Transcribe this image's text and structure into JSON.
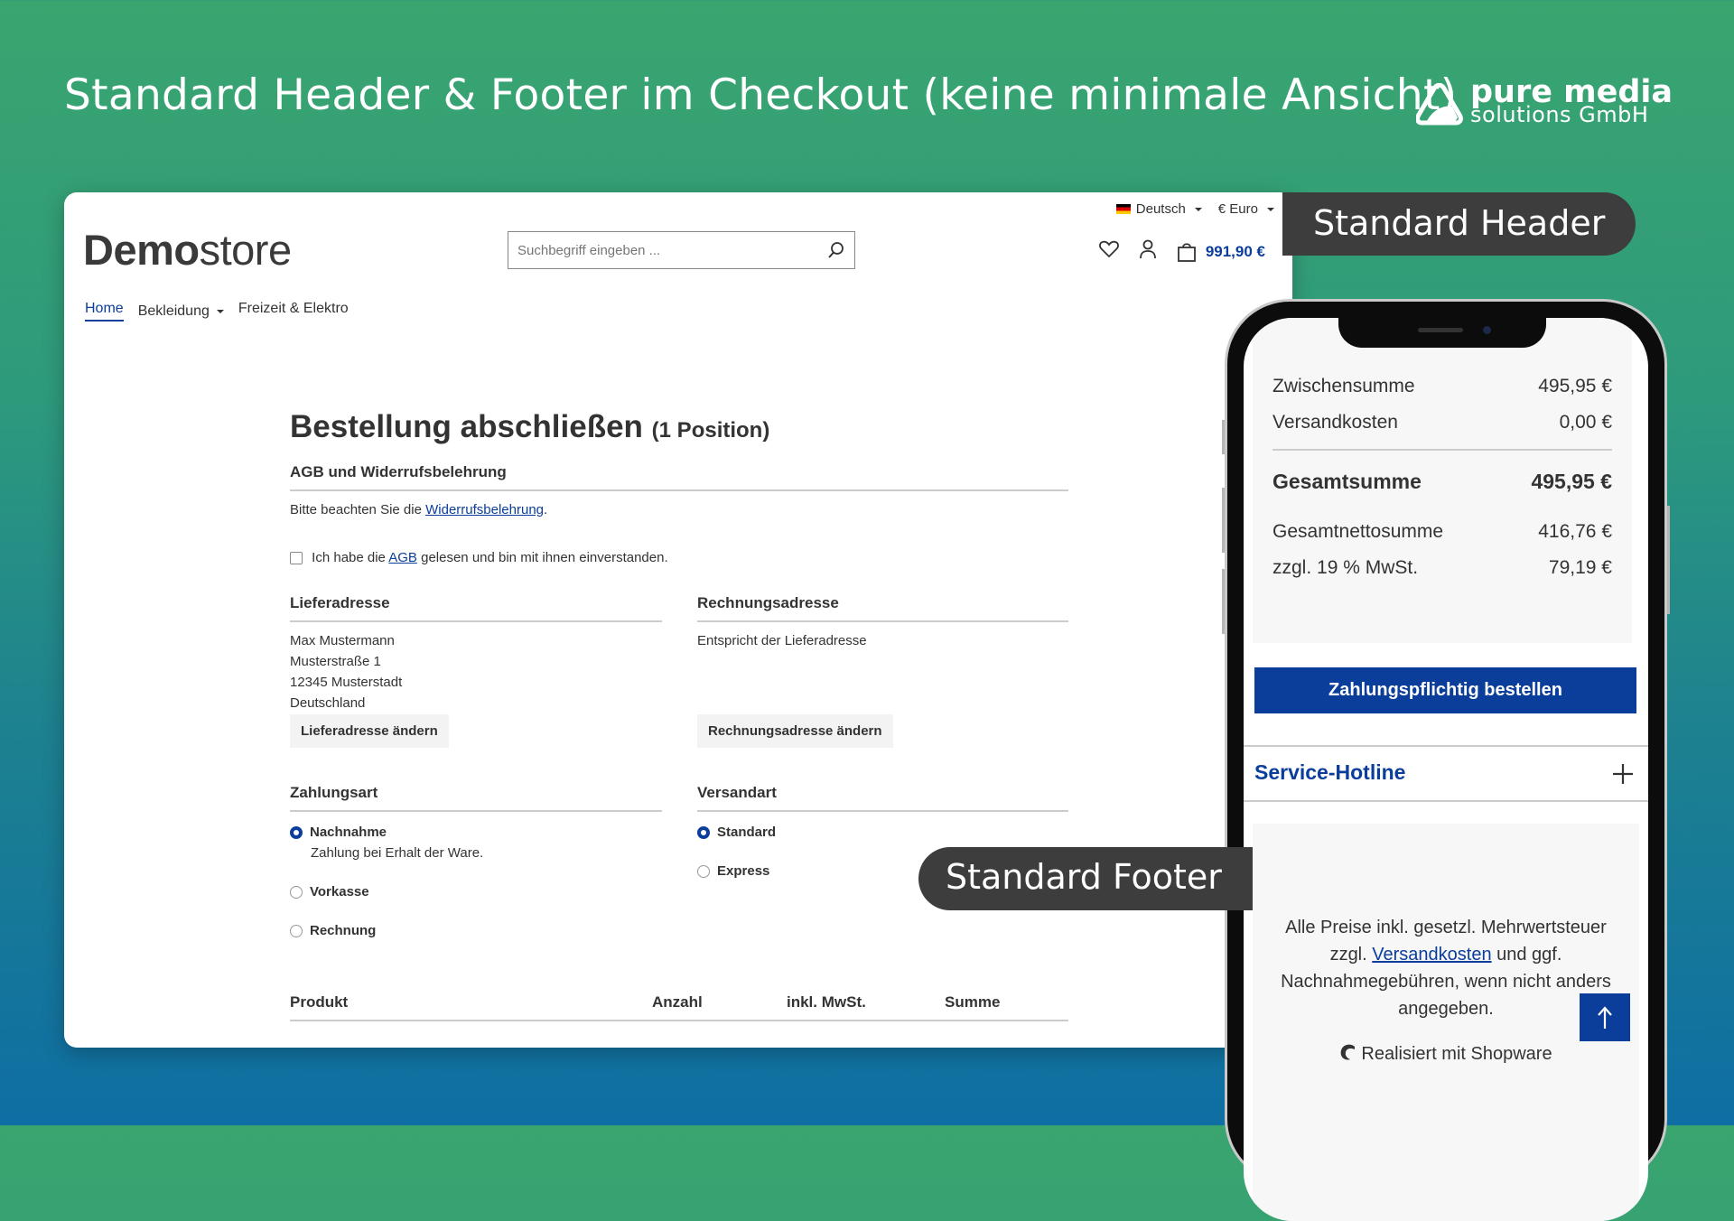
{
  "slide": {
    "headline": "Standard Header & Footer im Checkout (keine minimale Ansicht)",
    "brand_line1": "pure media",
    "brand_line2": "solutions GmbH",
    "label_header": "Standard Header",
    "label_footer": "Standard Footer"
  },
  "desktop": {
    "topbar": {
      "language": "Deutsch",
      "currency": "€ Euro"
    },
    "logo": {
      "bold": "Demo",
      "regular": "store"
    },
    "search": {
      "placeholder": "Suchbegriff eingeben ..."
    },
    "cart_total": "991,90 €",
    "nav": {
      "home": "Home",
      "clothing": "Bekleidung",
      "leisure": "Freizeit & Elektro"
    },
    "page": {
      "title": "Bestellung abschließen",
      "title_count": "(1 Position)",
      "terms_title": "AGB und Widerrufsbelehrung",
      "terms_text_before": "Bitte beachten Sie die ",
      "terms_link": "Widerrufsbelehrung",
      "terms_text_after": ".",
      "agb_before": "Ich habe die ",
      "agb_link": "AGB",
      "agb_after": " gelesen und bin mit ihnen einverstanden.",
      "shipping_title": "Lieferadresse",
      "shipping_address": [
        "Max Mustermann",
        "Musterstraße 1",
        "12345 Musterstadt",
        "Deutschland"
      ],
      "shipping_button": "Lieferadresse ändern",
      "billing_title": "Rechnungsadresse",
      "billing_text": "Entspricht der Lieferadresse",
      "billing_button": "Rechnungsadresse ändern",
      "payment_title": "Zahlungsart",
      "payment_options": [
        {
          "label": "Nachnahme",
          "desc": "Zahlung bei Erhalt der Ware.",
          "selected": true
        },
        {
          "label": "Vorkasse",
          "desc": "",
          "selected": false
        },
        {
          "label": "Rechnung",
          "desc": "",
          "selected": false
        }
      ],
      "shipping_method_title": "Versandart",
      "shipping_methods": [
        {
          "label": "Standard",
          "selected": true
        },
        {
          "label": "Express",
          "selected": false
        }
      ],
      "table_headers": {
        "product": "Produkt",
        "qty": "Anzahl",
        "vat": "inkl. MwSt.",
        "sum": "Summe"
      }
    }
  },
  "mobile": {
    "subtotal_label": "Zwischensumme",
    "subtotal_value": "495,95 €",
    "shipping_label": "Versandkosten",
    "shipping_value": "0,00 €",
    "total_label": "Gesamtsumme",
    "total_value": "495,95 €",
    "net_label": "Gesamtnettosumme",
    "net_value": "416,76 €",
    "tax_label": "zzgl. 19 % MwSt.",
    "tax_value": "79,19 €",
    "order_button": "Zahlungspflichtig bestellen",
    "hotline": "Service-Hotline",
    "vat_line1": "Alle Preise inkl. gesetzl. Mehrwertsteuer",
    "vat_line2_before": "zzgl. ",
    "vat_link": "Versandkosten",
    "vat_line2_after": " und ggf.",
    "vat_line3": "Nachnahmegebühren, wenn nicht anders",
    "vat_line4": "angegeben.",
    "powered_by": "Realisiert mit Shopware"
  },
  "colors": {
    "primary": "#0b3e9b",
    "pill": "#3d3d3d"
  }
}
